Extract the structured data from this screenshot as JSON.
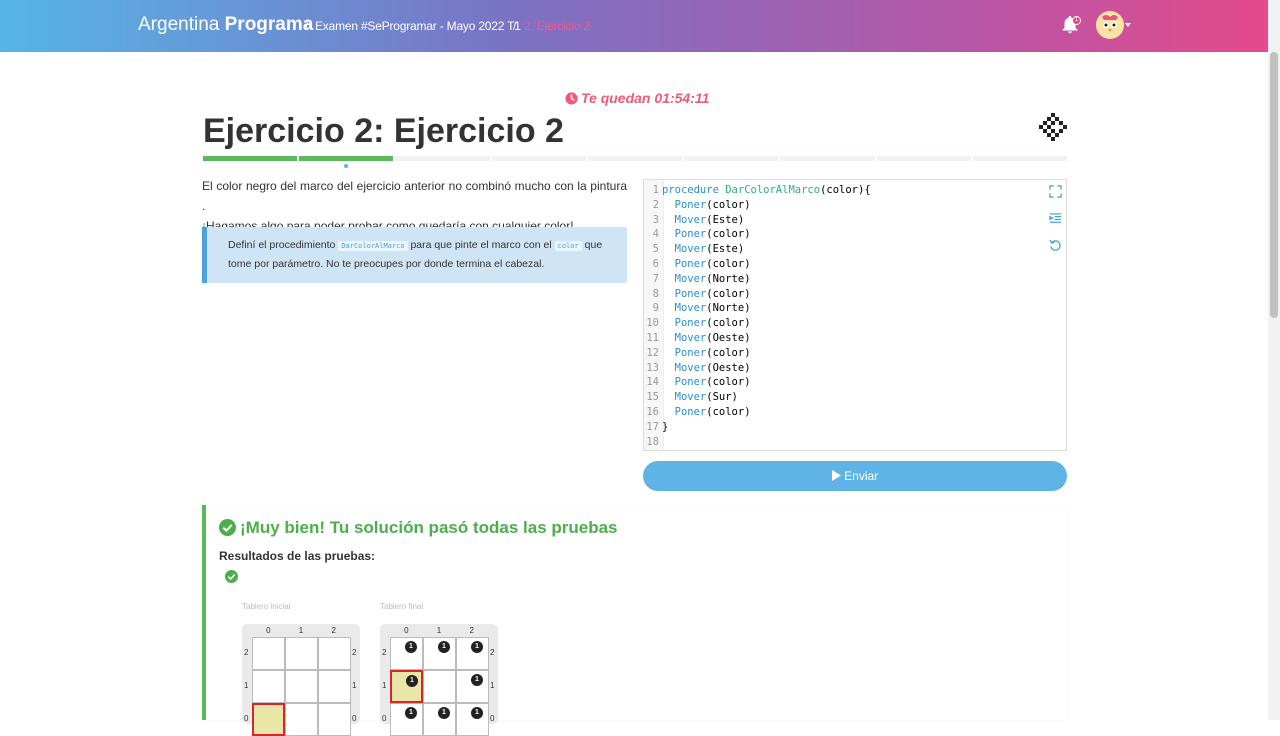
{
  "nav": {
    "brand_light": "Argentina",
    "brand_bold": "Programa",
    "breadcrumb": [
      {
        "label": "/"
      },
      {
        "label": "Examen #SeProgramar - Mayo 2022 T1"
      },
      {
        "label": "/"
      },
      {
        "label": "2. Ejercicio 2"
      }
    ],
    "notification_count": "1"
  },
  "timer": {
    "text": "Te quedan 01:54:11"
  },
  "exercise": {
    "title": "Ejercicio 2: Ejercicio 2",
    "progress": {
      "total": 9,
      "completed": 2,
      "current": 2
    },
    "description_1": "El color negro del marco del ejercicio anterior no combinó mucho con la pintura .",
    "description_2": "¡Hagamos algo para poder probar como quedaría con cualquier color!",
    "hint_1": "Definí el procedimiento",
    "hint_code_1": "DarColorAlMarco",
    "hint_2": "para que pinte el marco con el",
    "hint_code_2": "color",
    "hint_3": "que",
    "hint_4": "tome por parámetro. No te preocupes por donde termina el cabezal."
  },
  "editor": {
    "lines": [
      {
        "n": "1",
        "kw": "procedure",
        "fn": "DarColorAlMarco",
        "rest": "(color){"
      },
      {
        "n": "2",
        "kw": "  Poner",
        "rest": "(color)"
      },
      {
        "n": "3",
        "kw": "  Mover",
        "rest": "(Este)"
      },
      {
        "n": "4",
        "kw": "  Poner",
        "rest": "(color)"
      },
      {
        "n": "5",
        "kw": "  Mover",
        "rest": "(Este)"
      },
      {
        "n": "6",
        "kw": "  Poner",
        "rest": "(color)"
      },
      {
        "n": "7",
        "kw": "  Mover",
        "rest": "(Norte)"
      },
      {
        "n": "8",
        "kw": "  Poner",
        "rest": "(color)"
      },
      {
        "n": "9",
        "kw": "  Mover",
        "rest": "(Norte)"
      },
      {
        "n": "10",
        "kw": "  Poner",
        "rest": "(color)"
      },
      {
        "n": "11",
        "kw": "  Mover",
        "rest": "(Oeste)"
      },
      {
        "n": "12",
        "kw": "  Poner",
        "rest": "(color)"
      },
      {
        "n": "13",
        "kw": "  Mover",
        "rest": "(Oeste)"
      },
      {
        "n": "14",
        "kw": "  Poner",
        "rest": "(color)"
      },
      {
        "n": "15",
        "kw": "  Mover",
        "rest": "(Sur)"
      },
      {
        "n": "16",
        "kw": "  Poner",
        "rest": "(color)"
      },
      {
        "n": "17",
        "rest": "}"
      },
      {
        "n": "18",
        "rest": ""
      }
    ],
    "icons": [
      "fullscreen-icon",
      "indent-icon",
      "reset-icon"
    ]
  },
  "submit_label": "Enviar",
  "result": {
    "title": "¡Muy bien! Tu solución pasó todas las pruebas",
    "subtitle": "Resultados de las pruebas:",
    "initial_label": "Tablero inicial",
    "final_label": "Tablero final",
    "col_labels": [
      "0",
      "1",
      "2"
    ],
    "row_labels": [
      "2",
      "1",
      "0"
    ],
    "stone_count": "1"
  },
  "colors": {
    "accent_green": "#5cb85c",
    "accent_blue": "#5fb4e5",
    "accent_pink": "#f05a7a"
  }
}
